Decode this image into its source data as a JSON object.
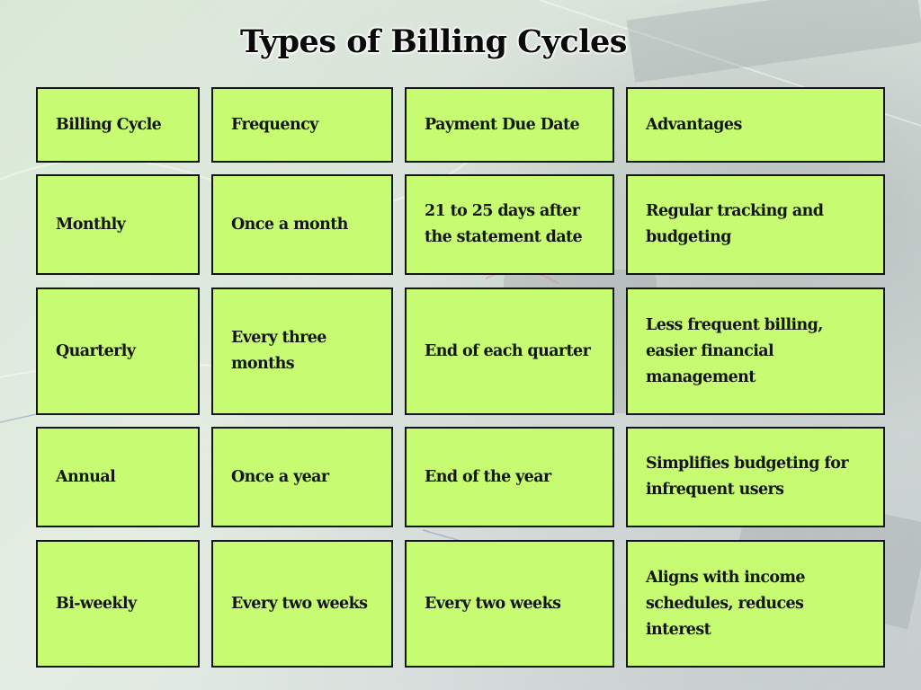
{
  "title": "Types of Billing Cycles",
  "table": {
    "headers": [
      "Billing Cycle",
      "Frequency",
      "Payment Due Date",
      "Advantages"
    ],
    "rows": [
      [
        "Monthly",
        "Once a month",
        "21 to 25 days after the statement date",
        "Regular tracking and budgeting"
      ],
      [
        "Quarterly",
        "Every three months",
        "End of each quarter",
        "Less frequent billing, easier financial management"
      ],
      [
        "Annual",
        "Once a year",
        "End of the year",
        "Simplifies budgeting for infrequent users"
      ],
      [
        "Bi-weekly",
        "Every two weeks",
        "Every two weeks",
        "Aligns with income schedules, reduces interest"
      ]
    ]
  },
  "colors": {
    "cell_fill": "#c6fb72",
    "cell_border": "#151515",
    "text": "#151515"
  }
}
